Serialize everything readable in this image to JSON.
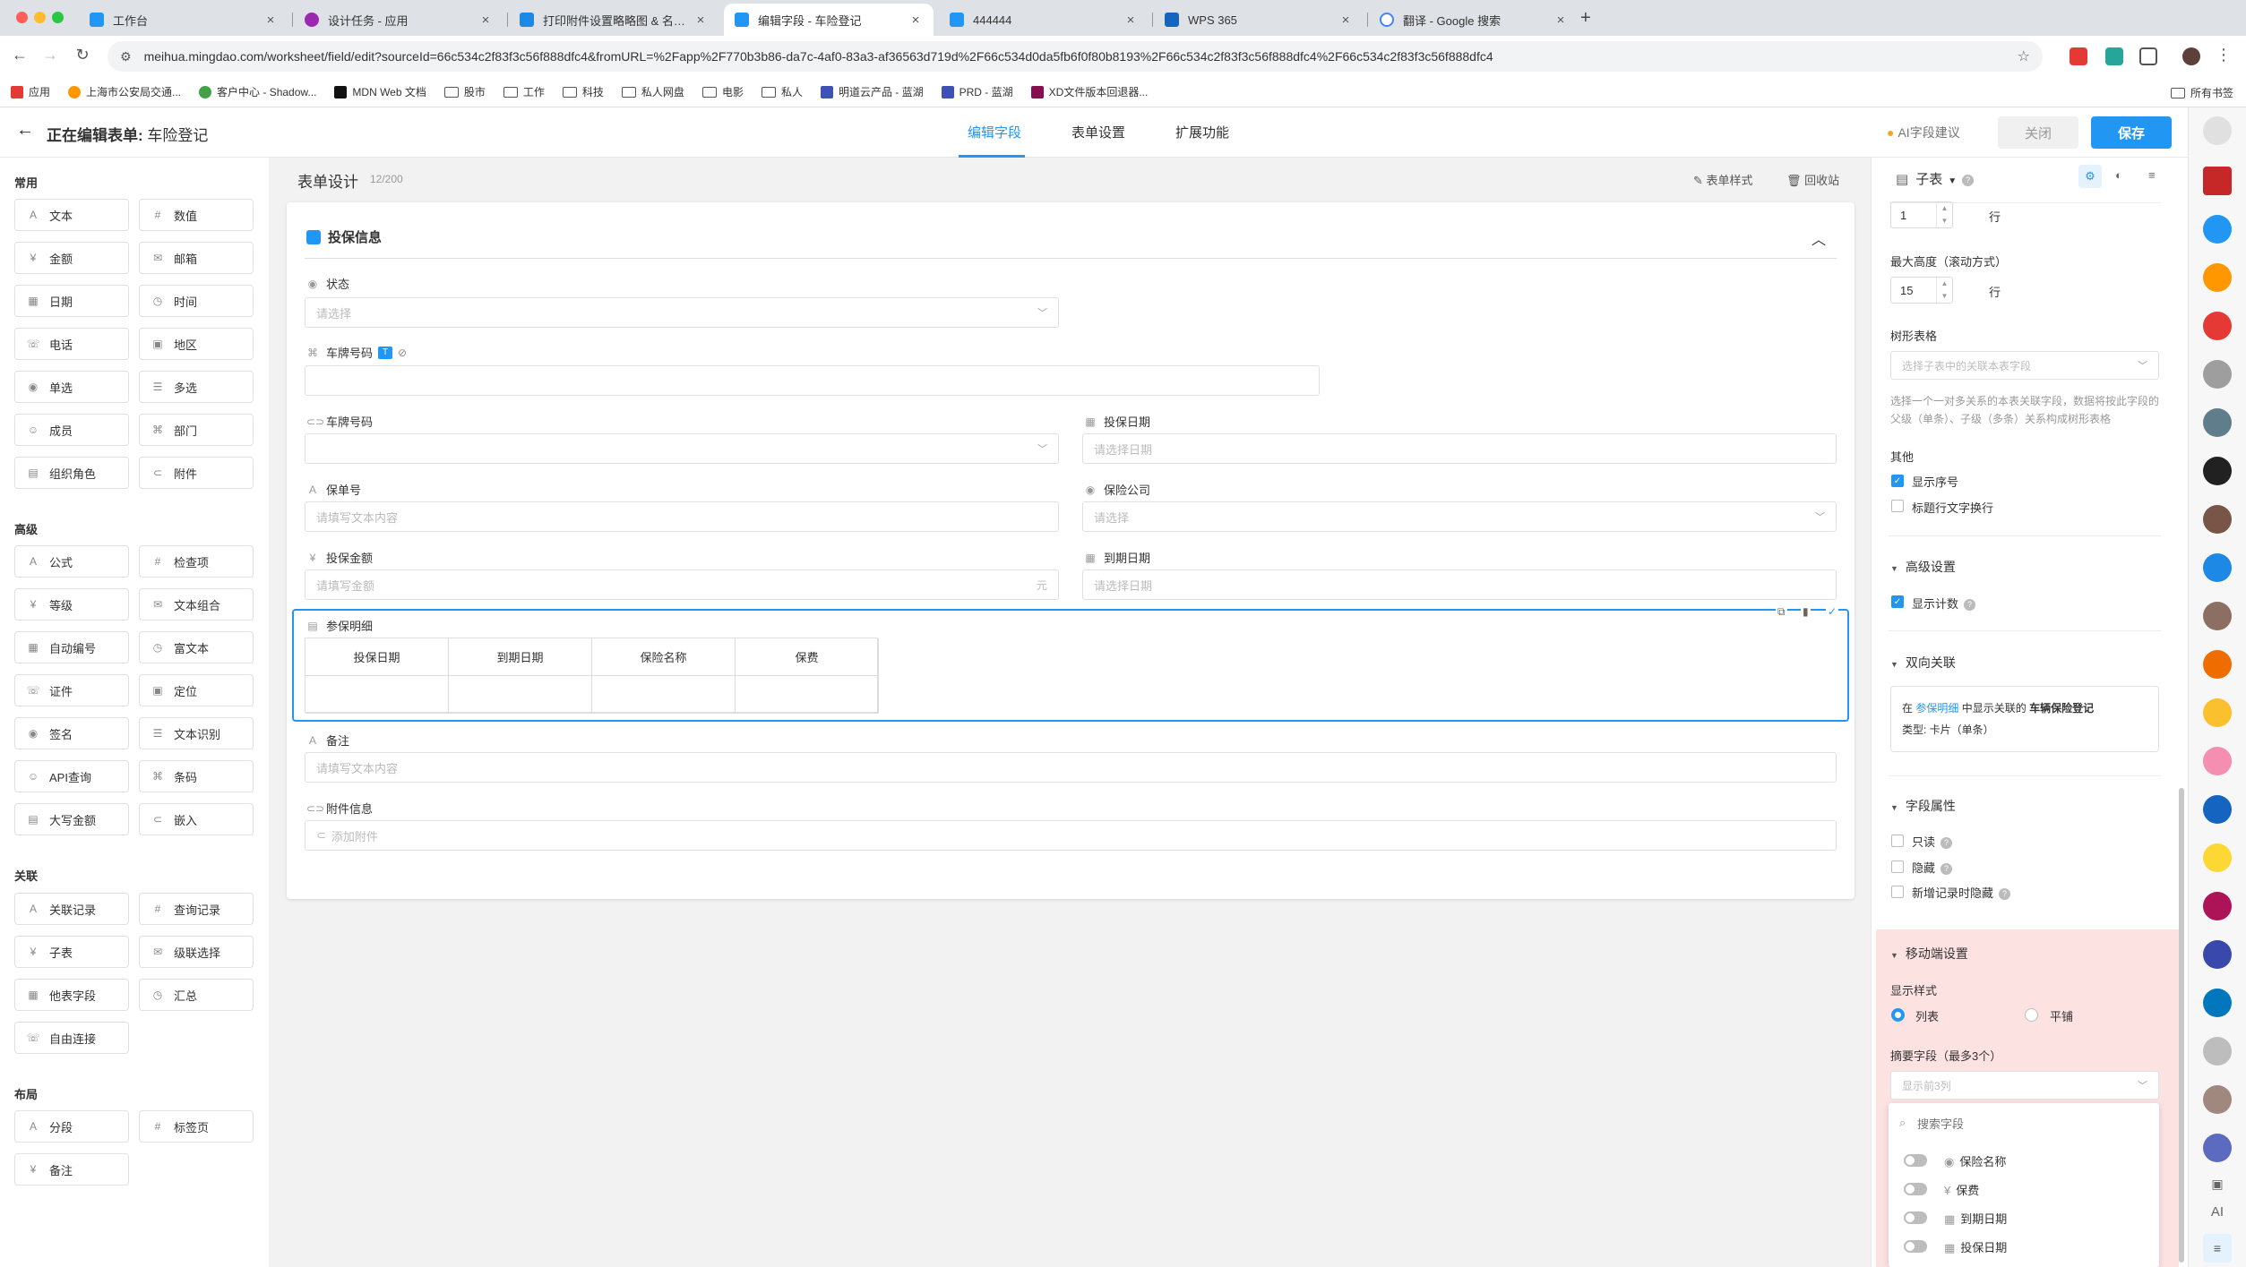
{
  "browser": {
    "tabs": [
      {
        "title": "工作台",
        "color": "#2196f3"
      },
      {
        "title": "设计任务 - 应用",
        "color": "#9c27b0"
      },
      {
        "title": "打印附件设置略略图 & 名称 - E",
        "color": "#1e88e5"
      },
      {
        "title": "编辑字段 - 车险登记",
        "color": "#2196f3"
      },
      {
        "title": "444444",
        "color": "#2196f3"
      },
      {
        "title": "WPS 365",
        "color": "#1565c0"
      },
      {
        "title": "翻译 - Google 搜索",
        "color": "#4285f4"
      }
    ],
    "url": "meihua.mingdao.com/worksheet/field/edit?sourceId=66c534c2f83f3c56f888dfc4&fromURL=%2Fapp%2F770b3b86-da7c-4af0-83a3-af36563d719d%2F66c534d0da5fb6f0f80b8193%2F66c534c2f83f3c56f888dfc4%2F66c534c2f83f3c56f888dfc4",
    "bookmarks": [
      "应用",
      "上海市公安局交通...",
      "客户中心 - Shadow...",
      "MDN Web 文档",
      "股市",
      "工作",
      "科技",
      "私人网盘",
      "电影",
      "私人",
      "明道云产品 - 蓝湖",
      "PRD - 蓝湖",
      "XD文件版本回退器..."
    ],
    "bookmarks_right": "所有书签"
  },
  "header": {
    "prefix": "正在编辑表单: ",
    "form_name": "车险登记",
    "tabs": [
      "编辑字段",
      "表单设置",
      "扩展功能"
    ],
    "ai_suggest": "AI字段建议",
    "close": "关闭",
    "save": "保存"
  },
  "palette": {
    "common_title": "常用",
    "common": [
      "文本",
      "数值",
      "金额",
      "邮箱",
      "日期",
      "时间",
      "电话",
      "地区",
      "单选",
      "多选",
      "成员",
      "部门",
      "组织角色",
      "附件"
    ],
    "advanced_title": "高级",
    "advanced": [
      "公式",
      "检查项",
      "等级",
      "文本组合",
      "自动编号",
      "富文本",
      "证件",
      "定位",
      "签名",
      "文本识别",
      "API查询",
      "条码",
      "大写金额",
      "嵌入"
    ],
    "relation_title": "关联",
    "relation": [
      "关联记录",
      "查询记录",
      "子表",
      "级联选择",
      "他表字段",
      "汇总",
      "自由连接"
    ],
    "layout_title": "布局",
    "layout": [
      "分段",
      "标签页",
      "备注"
    ]
  },
  "canvas": {
    "title": "表单设计",
    "count": "12/200",
    "style_btn": "表单样式",
    "recycle_btn": "回收站",
    "section": "投保信息",
    "fields": {
      "status": {
        "label": "状态",
        "placeholder": "请选择"
      },
      "plate1": {
        "label": "车牌号码",
        "badge": "T"
      },
      "plate2": {
        "label": "车牌号码"
      },
      "insure_date": {
        "label": "投保日期",
        "placeholder": "请选择日期"
      },
      "policy_no": {
        "label": "保单号",
        "placeholder": "请填写文本内容"
      },
      "company": {
        "label": "保险公司",
        "placeholder": "请选择"
      },
      "amount": {
        "label": "投保金额",
        "placeholder": "请填写金额",
        "unit": "元"
      },
      "expire_date": {
        "label": "到期日期",
        "placeholder": "请选择日期"
      },
      "detail": {
        "label": "参保明细",
        "columns": [
          "投保日期",
          "到期日期",
          "保险名称",
          "保费"
        ]
      },
      "remark": {
        "label": "备注",
        "placeholder": "请填写文本内容"
      },
      "attach": {
        "label": "附件信息",
        "placeholder": "添加附件"
      }
    }
  },
  "right": {
    "type_label": "子表",
    "rows_value": "1",
    "rows_unit": "行",
    "max_height_label": "最大高度（滚动方式）",
    "max_height_value": "15",
    "max_height_unit": "行",
    "tree_label": "树形表格",
    "tree_placeholder": "选择子表中的关联本表字段",
    "tree_desc": "选择一个一对多关系的本表关联字段，数据将按此字段的父级（单条）、子级（多条）关系构成树形表格",
    "other_label": "其他",
    "show_index": "显示序号",
    "wrap_title": "标题行文字换行",
    "advanced_label": "高级设置",
    "show_count": "显示计数",
    "bidirectional_label": "双向关联",
    "bi_text_pre": "在",
    "bi_link": "参保明细",
    "bi_text_mid": "中显示关联的",
    "bi_bold": "车辆保险登记",
    "bi_type": "类型: 卡片（单条）",
    "field_props_label": "字段属性",
    "readonly": "只读",
    "hidden": "隐藏",
    "hide_on_new": "新增记录时隐藏",
    "mobile_label": "移动端设置",
    "display_style": "显示样式",
    "style_list": "列表",
    "style_tile": "平铺",
    "summary_label": "摘要字段（最多3个）",
    "summary_placeholder": "显示前3列",
    "search_placeholder": "搜索字段",
    "summary_fields": [
      "保险名称",
      "保费",
      "到期日期",
      "投保日期"
    ]
  }
}
